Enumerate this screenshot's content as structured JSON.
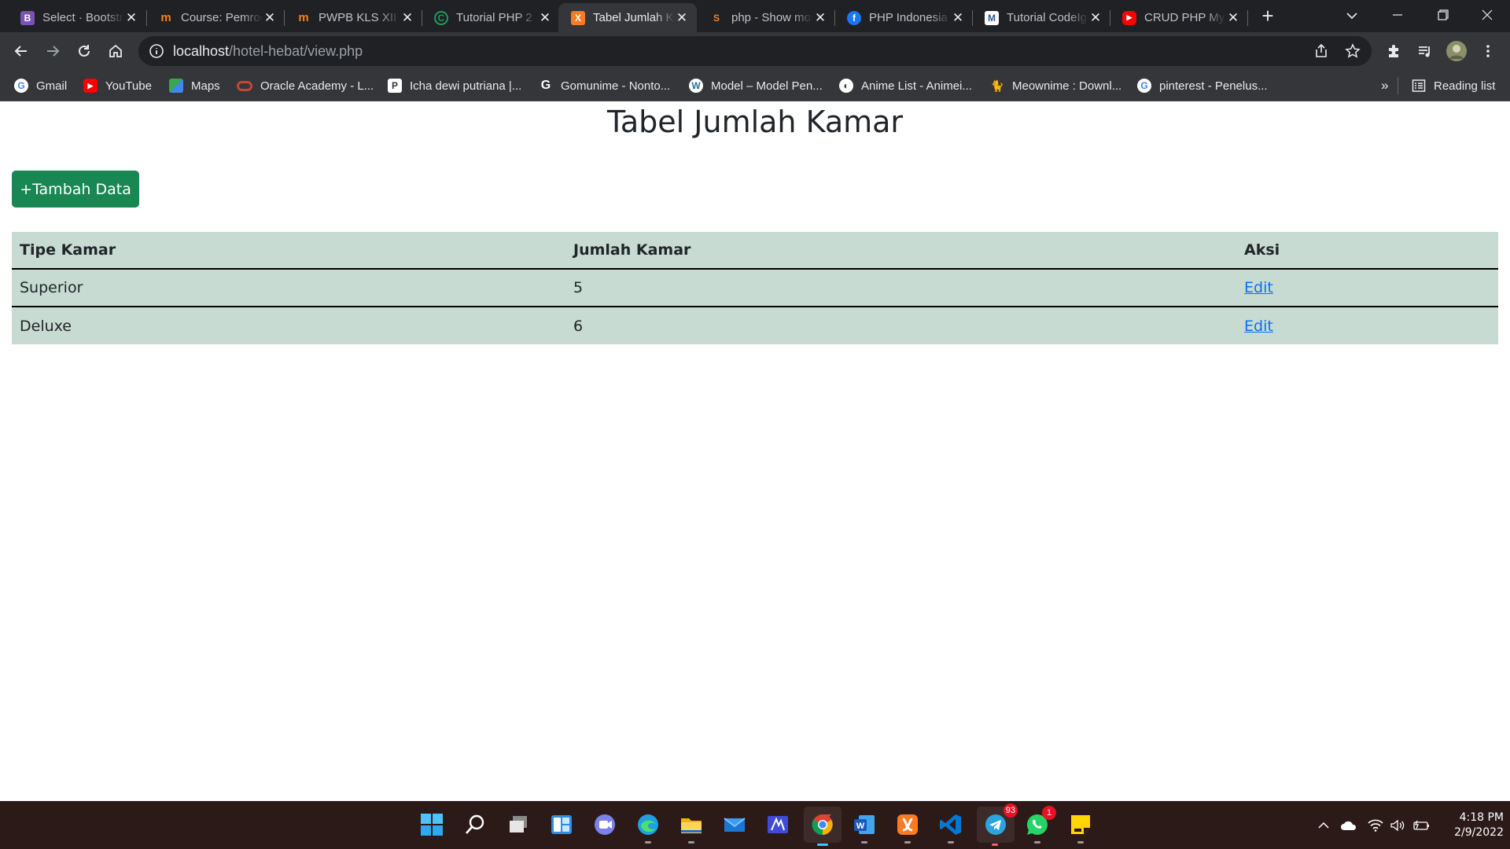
{
  "browser": {
    "tabs": [
      {
        "title": "Select · Bootstrap",
        "icon": "bootstrap-icon",
        "favicon_text": "B",
        "color": "#7952b3"
      },
      {
        "title": "Course: Pemrograman",
        "icon": "moodle-icon",
        "favicon_text": "m",
        "color": "#f98012"
      },
      {
        "title": "PWPB KLS XII",
        "icon": "moodle-icon",
        "favicon_text": "m",
        "color": "#f98012"
      },
      {
        "title": "Tutorial PHP 2",
        "icon": "codepolitan-icon",
        "favicon_text": "C",
        "color": "#1b9e5a"
      },
      {
        "title": "Tabel Jumlah Kamar",
        "icon": "xampp-icon",
        "favicon_text": "X",
        "color": "#fb7a24",
        "active": true
      },
      {
        "title": "php - Show more",
        "icon": "stackoverflow-icon",
        "favicon_text": "S",
        "color": "#f48024"
      },
      {
        "title": "PHP Indonesia",
        "icon": "facebook-icon",
        "favicon_text": "f",
        "color": "#1877f2"
      },
      {
        "title": "Tutorial CodeIgniter",
        "icon": "malasngoding-icon",
        "favicon_text": "M",
        "color": "#2b579a"
      },
      {
        "title": "CRUD PHP MySQL",
        "icon": "youtube-icon",
        "favicon_text": "▶",
        "color": "#ff0000"
      }
    ],
    "url_host": "localhost",
    "url_path": "/hotel-hebat/view.php",
    "bookmarks": [
      {
        "label": "Gmail",
        "icon": "google-icon",
        "color": "#4285f4"
      },
      {
        "label": "YouTube",
        "icon": "youtube-icon",
        "color": "#ff0000"
      },
      {
        "label": "Maps",
        "icon": "maps-icon",
        "color": "#34a853"
      },
      {
        "label": "Oracle Academy - L...",
        "icon": "oracle-icon",
        "color": "#c74634"
      },
      {
        "label": "Icha dewi putriana |...",
        "icon": "pixiv-icon",
        "color": "#ffffff"
      },
      {
        "label": "Gomunime - Nonto...",
        "icon": "gomunime-icon",
        "color": "#ffffff"
      },
      {
        "label": "Model – Model Pen...",
        "icon": "wordpress-icon",
        "color": "#ffffff"
      },
      {
        "label": "Anime List - Animei...",
        "icon": "animeindo-icon",
        "color": "#ffffff"
      },
      {
        "label": "Meownime : Downl...",
        "icon": "cat-icon",
        "color": "#000000"
      },
      {
        "label": "pinterest - Penelus...",
        "icon": "google-icon",
        "color": "#4285f4"
      }
    ],
    "more_bookmarks": "»",
    "reading_list": "Reading list"
  },
  "page": {
    "title": "Tabel Jumlah Kamar",
    "add_button": "+Tambah Data",
    "table": {
      "headers": [
        "Tipe Kamar",
        "Jumlah Kamar",
        "Aksi"
      ],
      "rows": [
        {
          "tipe": "Superior",
          "jumlah": "5",
          "aksi": "Edit"
        },
        {
          "tipe": "Deluxe",
          "jumlah": "6",
          "aksi": "Edit"
        }
      ]
    }
  },
  "taskbar": {
    "apps": [
      "windows-start-icon",
      "search-icon",
      "task-view-icon",
      "widgets-icon",
      "teams-chat-icon",
      "edge-icon",
      "file-explorer-icon",
      "mail-icon",
      "app-icon",
      "chrome-icon",
      "word-icon",
      "xampp-icon",
      "vscode-icon",
      "telegram-icon",
      "whatsapp-icon",
      "sticky-notes-icon"
    ],
    "telegram_badge": "93",
    "whatsapp_badge": "1",
    "time": "4:18 PM",
    "date": "2/9/2022"
  },
  "colors": {
    "table_bg": "#c7dbd2",
    "button_green": "#198754",
    "link_blue": "#0d6efd",
    "taskbar_bg": "#2c1a19"
  }
}
